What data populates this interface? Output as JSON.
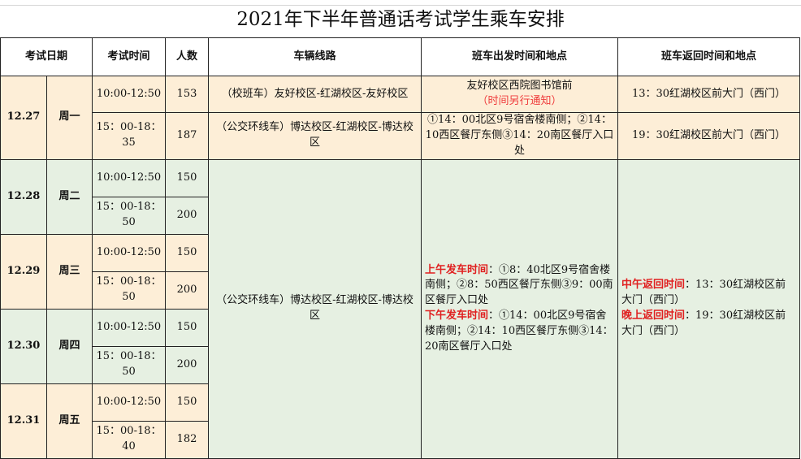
{
  "title": "2021年下半年普通话考试学生乘车安排",
  "headers": {
    "date": "考试日期",
    "time": "考试时间",
    "count": "人数",
    "route": "车辆线路",
    "departure": "班车出发时间和地点",
    "return": "班车返回时间和地点"
  },
  "days": [
    {
      "date": "12.27",
      "weekday": "周一",
      "slots": [
        {
          "time": "10:00-12:50",
          "count": "153"
        },
        {
          "time": "15：00-18：35",
          "count": "187"
        }
      ]
    },
    {
      "date": "12.28",
      "weekday": "周二",
      "slots": [
        {
          "time": "10:00-12:50",
          "count": "150"
        },
        {
          "time": "15：00-18：50",
          "count": "200"
        }
      ]
    },
    {
      "date": "12.29",
      "weekday": "周三",
      "slots": [
        {
          "time": "10:00-12:50",
          "count": "150"
        },
        {
          "time": "15：00-18：50",
          "count": "200"
        }
      ]
    },
    {
      "date": "12.30",
      "weekday": "周四",
      "slots": [
        {
          "time": "10:00-12:50",
          "count": "150"
        },
        {
          "time": "15：00-18：50",
          "count": "200"
        }
      ]
    },
    {
      "date": "12.31",
      "weekday": "周五",
      "slots": [
        {
          "time": "10:00-12:50",
          "count": "150"
        },
        {
          "time": "15：00-18：40",
          "count": "182"
        }
      ]
    }
  ],
  "first_day_rows": [
    {
      "route": "（校班车）友好校区-红湖校区-友好校区",
      "departure": "友好校区西院图书馆前",
      "departure_note": "（时间另行通知）",
      "return": "13：30红湖校区前大门（西门）"
    },
    {
      "route": "（公交环线车）博达校区-红湖校区-博达校区",
      "departure": "①14：00北区9号宿舍楼南侧；②14：10西区餐厅东侧③14：20南区餐厅入口处",
      "return": "19：30红湖校区前大门（西门）"
    }
  ],
  "merged": {
    "route": "（公交环线车）博达校区-红湖校区-博达校区",
    "morning_label": "上午发车时间",
    "morning_text": "：①8：40北区9号宿舍楼南侧；②8：50西区餐厅东侧③9：00南区餐厅入口处",
    "afternoon_label": "下午发车时间",
    "afternoon_text": "：①14：00北区9号宿舍楼南侧；②14：10西区餐厅东侧③14：20南区餐厅入口处",
    "noon_return_label": "中午返回时间",
    "noon_return_text": "：13：30红湖校区前大门（西门）",
    "evening_return_label": "晚上返回时间",
    "evening_return_text": "：19：30红湖校区前大门（西门）"
  },
  "colors": {
    "yellow_row": "#fdeed7",
    "green_row": "#e6f0e2",
    "red_text": "#e02020"
  }
}
